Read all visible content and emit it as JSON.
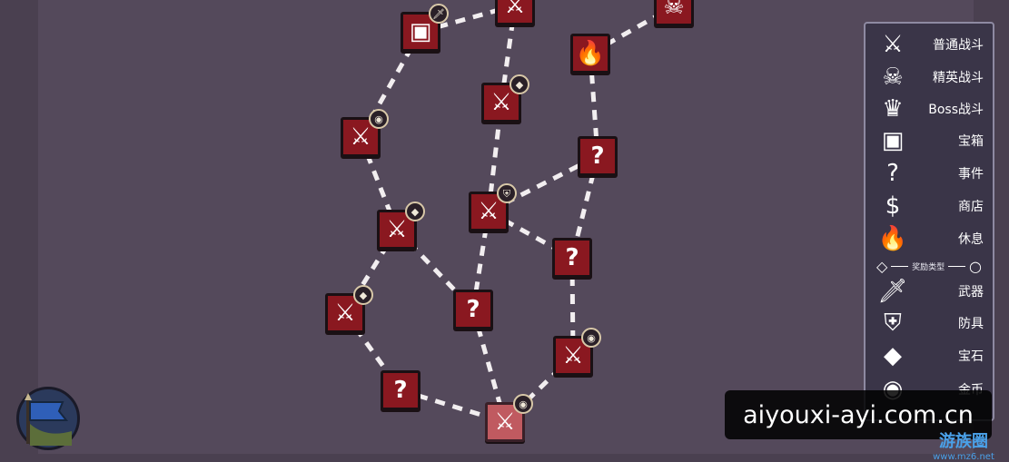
{
  "nodes": [
    {
      "id": "n1",
      "type": "battle",
      "glyph": "⚔"
    },
    {
      "id": "n2",
      "type": "chest",
      "glyph": "▣",
      "badge": "🗡"
    },
    {
      "id": "n3",
      "type": "boss",
      "glyph": "☠"
    },
    {
      "id": "n4",
      "type": "rest",
      "glyph": "🔥"
    },
    {
      "id": "n5",
      "type": "battle",
      "glyph": "⚔",
      "badge": "◆"
    },
    {
      "id": "n6",
      "type": "battle",
      "glyph": "⚔",
      "badge": "◉"
    },
    {
      "id": "n7",
      "type": "event",
      "glyph": "?"
    },
    {
      "id": "n8",
      "type": "battle",
      "glyph": "⚔",
      "badge": "⛨"
    },
    {
      "id": "n9",
      "type": "battle",
      "glyph": "⚔",
      "badge": "◆"
    },
    {
      "id": "n10",
      "type": "event",
      "glyph": "?"
    },
    {
      "id": "n11",
      "type": "battle",
      "glyph": "⚔",
      "badge": "◆"
    },
    {
      "id": "n12",
      "type": "event",
      "glyph": "?"
    },
    {
      "id": "n13",
      "type": "battle",
      "glyph": "⚔",
      "badge": "◉"
    },
    {
      "id": "n14",
      "type": "event",
      "glyph": "?"
    },
    {
      "id": "n15",
      "type": "battle",
      "glyph": "⚔",
      "badge": "◉",
      "current": true
    }
  ],
  "legend": {
    "items": [
      {
        "icon": "⚔",
        "label": "普通战斗"
      },
      {
        "icon": "☠",
        "label": "精英战斗"
      },
      {
        "icon": "♛",
        "label": "Boss战斗"
      },
      {
        "icon": "▣",
        "label": "宝箱"
      },
      {
        "icon": "?",
        "label": "事件"
      },
      {
        "icon": "$",
        "label": "商店"
      },
      {
        "icon": "🔥",
        "label": "休息"
      }
    ],
    "divider_label": "奖励类型",
    "rewards": [
      {
        "icon": "🗡",
        "label": "武器"
      },
      {
        "icon": "⛨",
        "label": "防具"
      },
      {
        "icon": "◆",
        "label": "宝石"
      },
      {
        "icon": "◉",
        "label": "金币"
      }
    ]
  },
  "watermark": {
    "text": "aiyouxi-ayi.com.cn",
    "mark": "游族圈",
    "mark_sub": "www.mz6.net"
  },
  "colors": {
    "node": "#8a1820",
    "path": "#ffffff",
    "legend_bg": "#3a3548"
  }
}
